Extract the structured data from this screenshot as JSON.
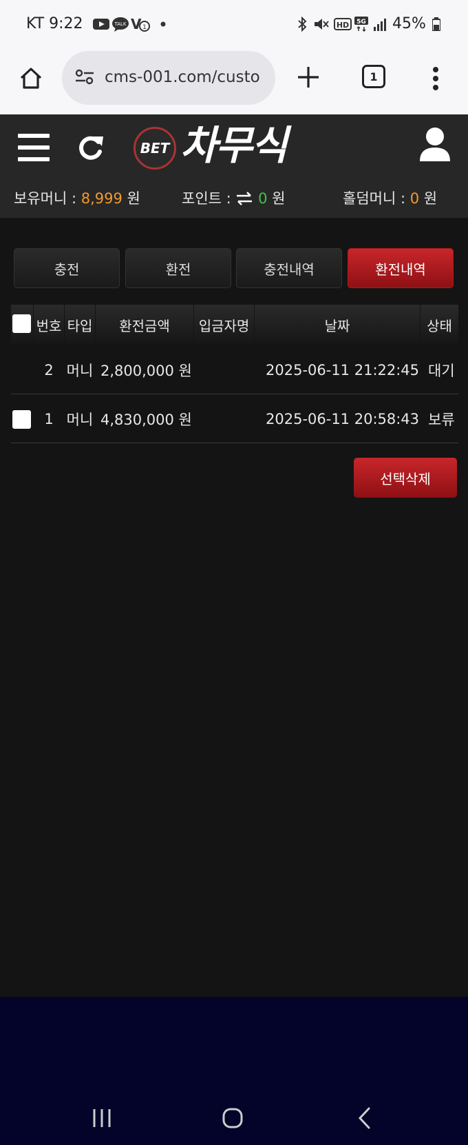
{
  "status_bar": {
    "carrier_time": "KT 9:22",
    "battery": "45%",
    "icons": [
      "youtube-icon",
      "talk-icon",
      "v1-icon",
      "dot-icon",
      "bluetooth-icon",
      "mute-icon",
      "hd-icon",
      "5g-icon",
      "signal-icon",
      "battery-icon"
    ]
  },
  "browser": {
    "url": "cms-001.com/custo",
    "tab_count": "1"
  },
  "header": {
    "logo_bet": "BET",
    "logo_title": "차무식",
    "balances": {
      "money_label": "보유머니 : ",
      "money_value": "8,999",
      "money_unit": " 원",
      "point_label": "포인트 : ",
      "point_value": "0",
      "point_unit": " 원",
      "holdem_label": "홀덤머니 : ",
      "holdem_value": "0",
      "holdem_unit": " 원"
    }
  },
  "tabs": [
    {
      "label": "충전",
      "active": false
    },
    {
      "label": "환전",
      "active": false
    },
    {
      "label": "충전내역",
      "active": false
    },
    {
      "label": "환전내역",
      "active": true
    }
  ],
  "table": {
    "columns": [
      "번호",
      "타입",
      "환전금액",
      "입금자명",
      "날짜",
      "상태"
    ],
    "rows": [
      {
        "checkbox": false,
        "no": "2",
        "type": "머니",
        "amount": "2,800,000 원",
        "depositor": "",
        "date": "2025-06-11 21:22:45",
        "status": "대기"
      },
      {
        "checkbox": true,
        "no": "1",
        "type": "머니",
        "amount": "4,830,000 원",
        "depositor": "",
        "date": "2025-06-11 20:58:43",
        "status": "보류"
      }
    ]
  },
  "actions": {
    "delete_selected": "선택삭제"
  },
  "colors": {
    "accent_red": "#c8262a",
    "money_orange": "#f29a2e",
    "point_green": "#44c24a",
    "nav_bg": "#04042a"
  }
}
